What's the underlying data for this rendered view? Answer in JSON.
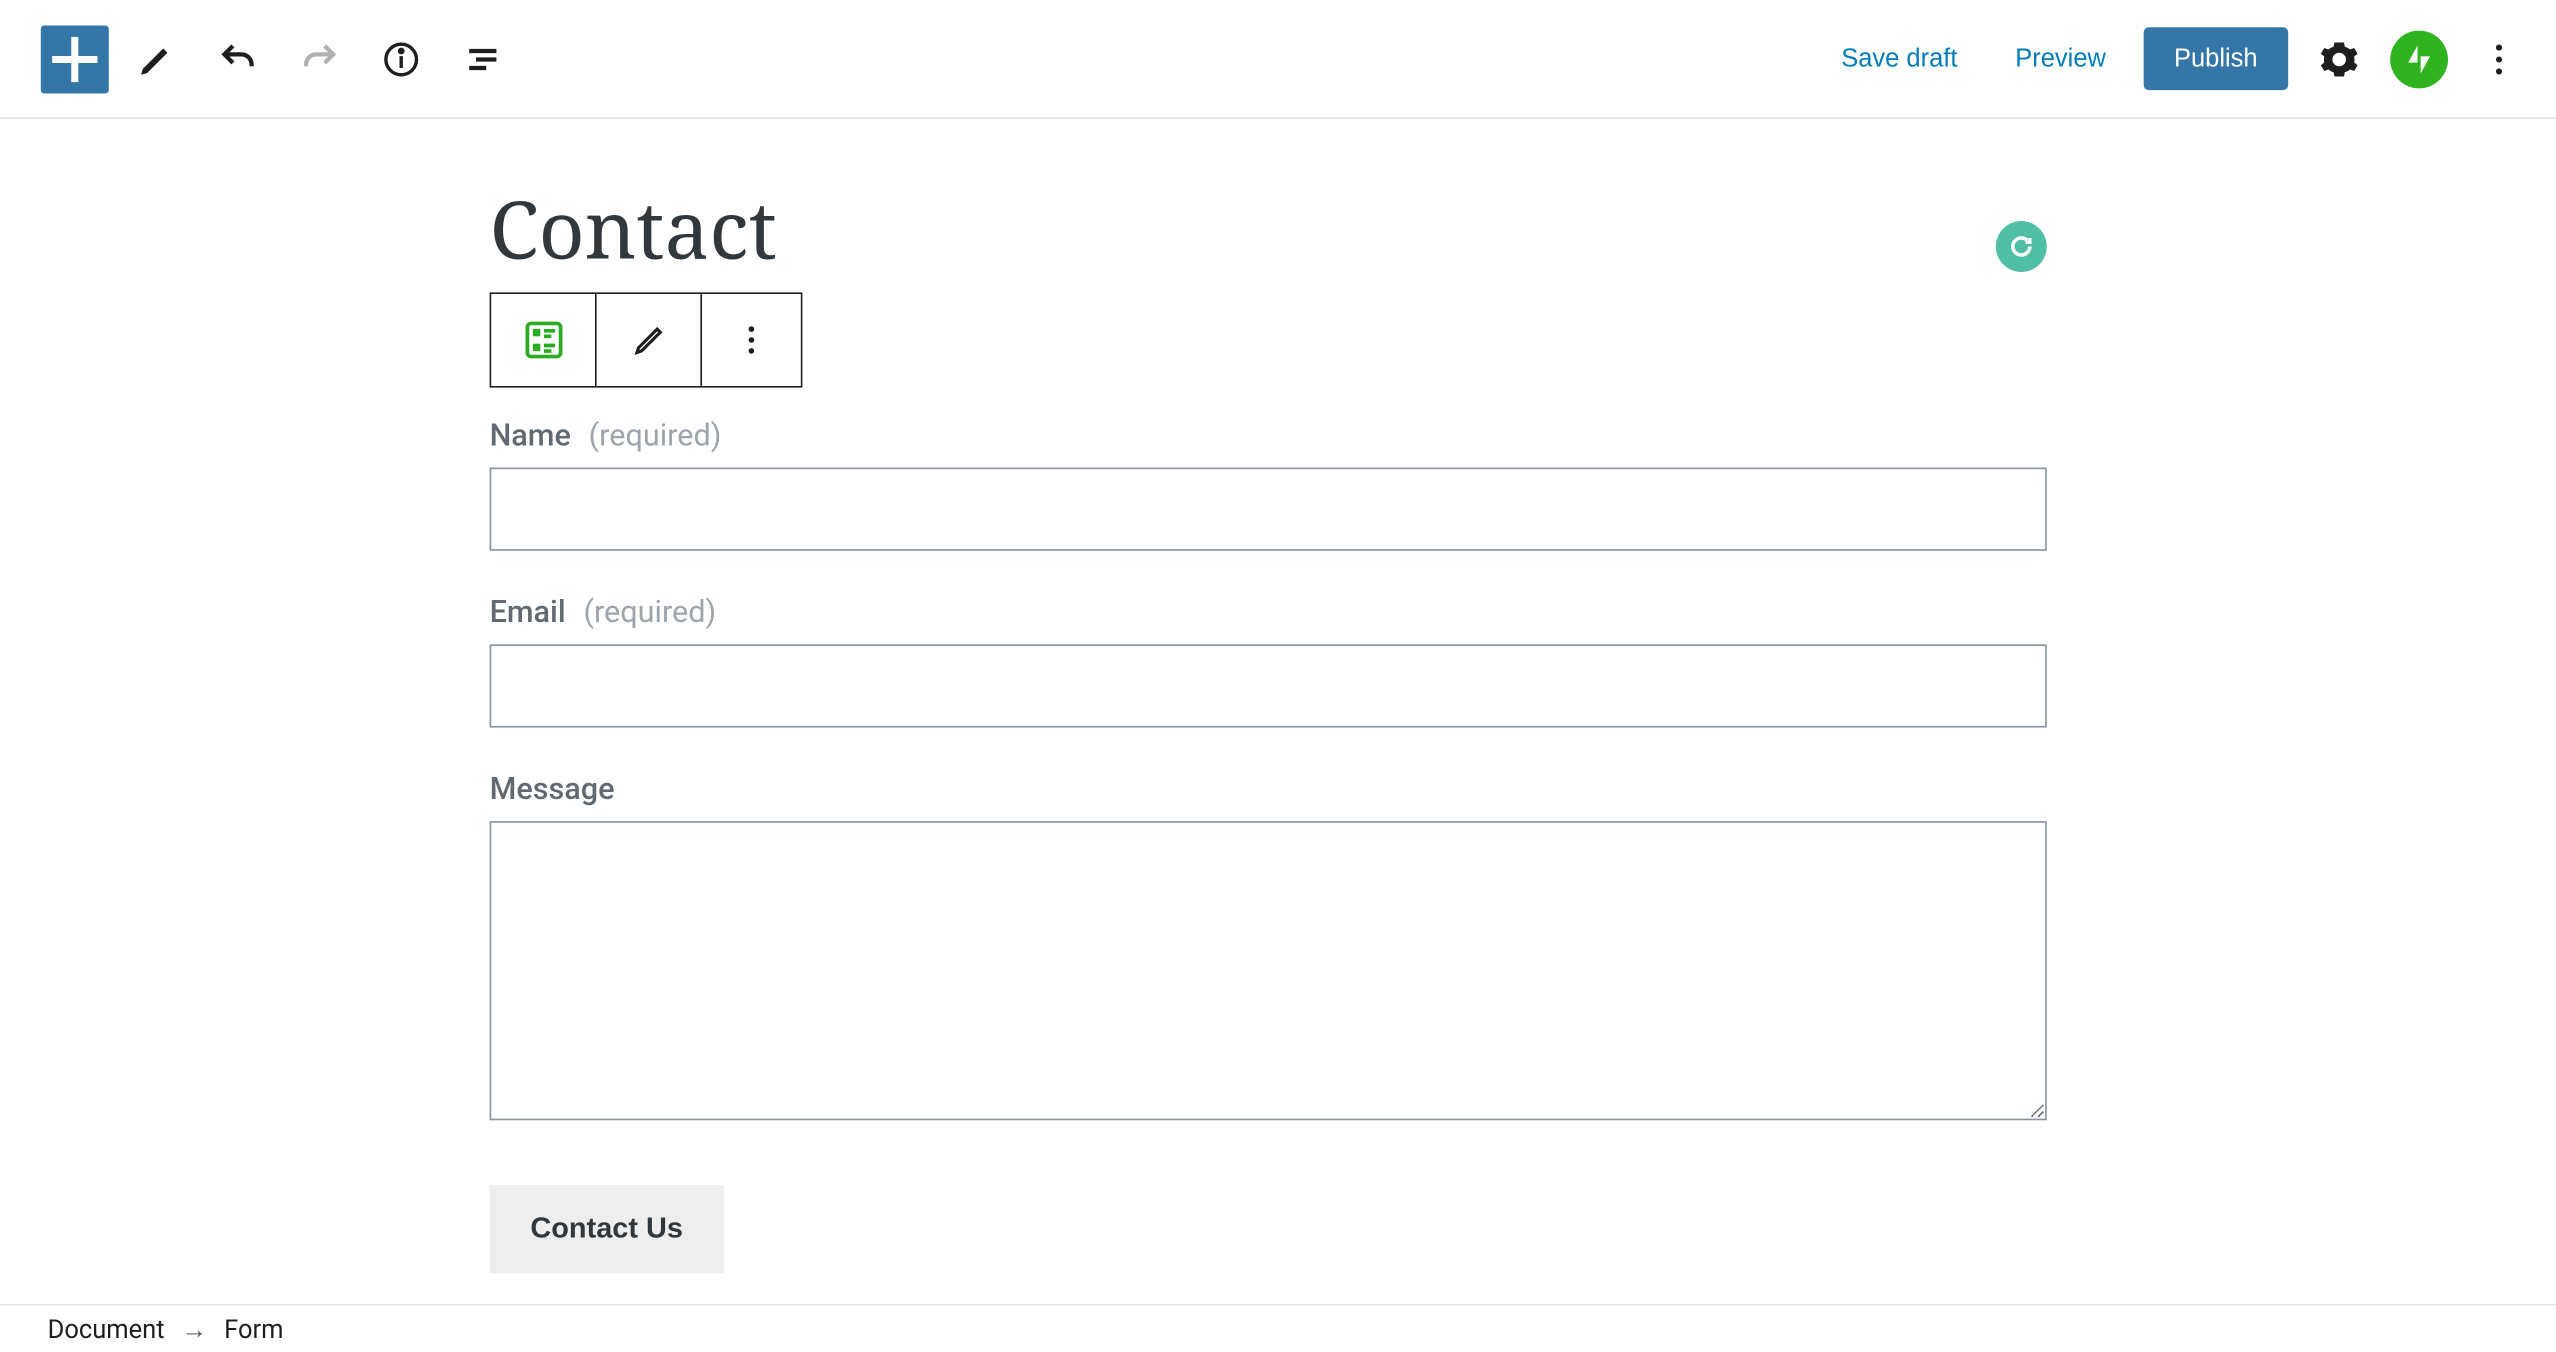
{
  "topbar": {
    "save_draft": "Save draft",
    "preview": "Preview",
    "publish": "Publish"
  },
  "page": {
    "title": "Contact"
  },
  "form": {
    "fields": [
      {
        "label": "Name",
        "required_suffix": "(required)",
        "type": "text",
        "value": ""
      },
      {
        "label": "Email",
        "required_suffix": "(required)",
        "type": "text",
        "value": ""
      },
      {
        "label": "Message",
        "required_suffix": "",
        "type": "textarea",
        "value": ""
      }
    ],
    "submit_label": "Contact Us"
  },
  "breadcrumb": {
    "root": "Document",
    "current": "Form"
  },
  "icons": {
    "add": "add-icon",
    "edit_tool": "edit-tool-icon",
    "undo": "undo-icon",
    "redo": "redo-icon",
    "info": "info-icon",
    "outline": "outline-icon",
    "settings": "gear-icon",
    "jetpack": "jetpack-icon",
    "more": "more-vertical-icon",
    "form_block": "form-block-icon",
    "pencil": "pencil-icon",
    "grammarly": "grammarly-icon"
  }
}
